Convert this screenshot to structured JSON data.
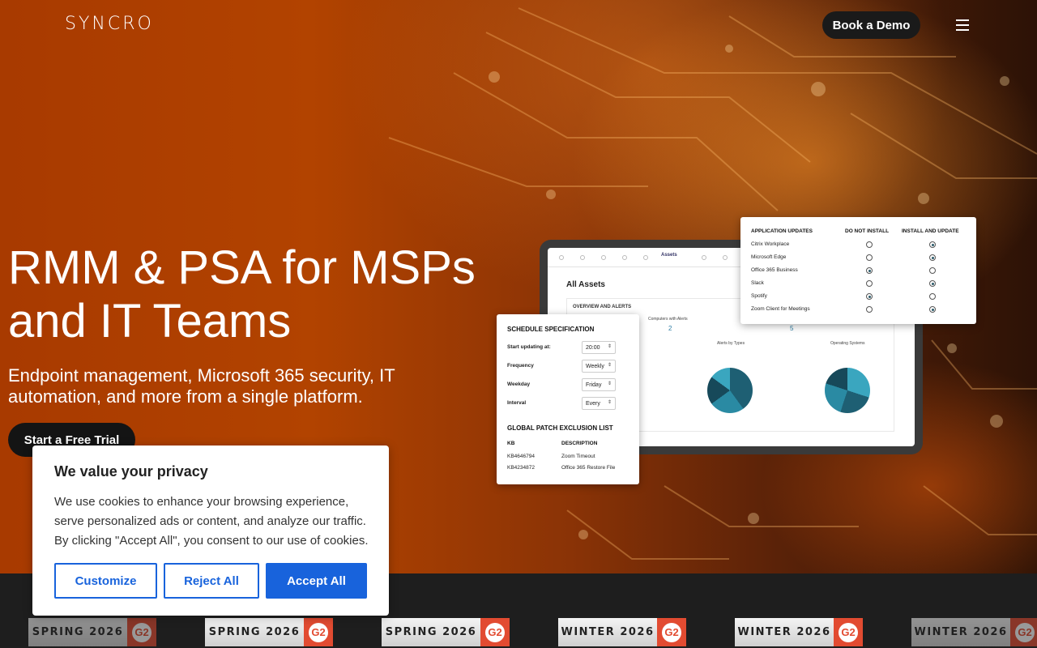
{
  "header": {
    "logo": "SYNCRO",
    "demo_label": "Book a Demo"
  },
  "hero": {
    "headline": "RMM & PSA for MSPs and IT Teams",
    "subhead": "Endpoint management, Microsoft 365 security, IT automation, and more from a single platform.",
    "cta_label": "Start a Free Trial"
  },
  "dashboard": {
    "tab": "Assets",
    "title": "All Assets",
    "overview_title": "OVERVIEW AND ALERTS",
    "stat_label": "Computers with Alerts",
    "stat_value_1": "2",
    "stat_value_2": "5",
    "chart1_title": "Alerts by Types",
    "chart2_title": "Operating Systems"
  },
  "schedule": {
    "title": "SCHEDULE SPECIFICATION",
    "rows": [
      {
        "label": "Start updating at:",
        "value": "20:00"
      },
      {
        "label": "Frequency",
        "value": "Weekly"
      },
      {
        "label": "Weekday",
        "value": "Friday"
      },
      {
        "label": "Interval",
        "value": "Every"
      }
    ],
    "exclusion_title": "GLOBAL PATCH EXCLUSION LIST",
    "col_kb": "KB",
    "col_desc": "DESCRIPTION",
    "exclusions": [
      {
        "kb": "KB4646794",
        "desc": "Zoom Timeout"
      },
      {
        "kb": "KB4234872",
        "desc": "Office 365 Restore File"
      }
    ]
  },
  "app_updates": {
    "title": "APPLICATION UPDATES",
    "col_no": "DO NOT INSTALL",
    "col_yes": "INSTALL AND UPDATE",
    "apps": [
      {
        "name": "Citrix Workplace",
        "install": true
      },
      {
        "name": "Microsoft Edge",
        "install": true
      },
      {
        "name": "Office 365 Business",
        "install": false
      },
      {
        "name": "Slack",
        "install": true
      },
      {
        "name": "Spotify",
        "install": false
      },
      {
        "name": "Zoom Client for Meetings",
        "install": true
      }
    ]
  },
  "cookie": {
    "title": "We value your privacy",
    "text": "We use cookies to enhance your browsing experience, serve personalized ads or content, and analyze our traffic. By clicking \"Accept All\", you consent to our use of cookies.",
    "customize": "Customize",
    "reject": "Reject All",
    "accept": "Accept All"
  },
  "badges": [
    {
      "season": "SPRING 2026",
      "icon": "G2"
    },
    {
      "season": "SPRING 2026",
      "icon": "G2"
    },
    {
      "season": "SPRING 2026",
      "icon": "G2"
    },
    {
      "season": "WINTER 2026",
      "icon": "G2"
    },
    {
      "season": "WINTER 2026",
      "icon": "G2"
    },
    {
      "season": "WINTER 2026",
      "icon": "G2"
    }
  ],
  "colors": {
    "accent_blue": "#1863dc",
    "g2_red": "#e24b31",
    "chart_teal": "#2f7ea5"
  }
}
